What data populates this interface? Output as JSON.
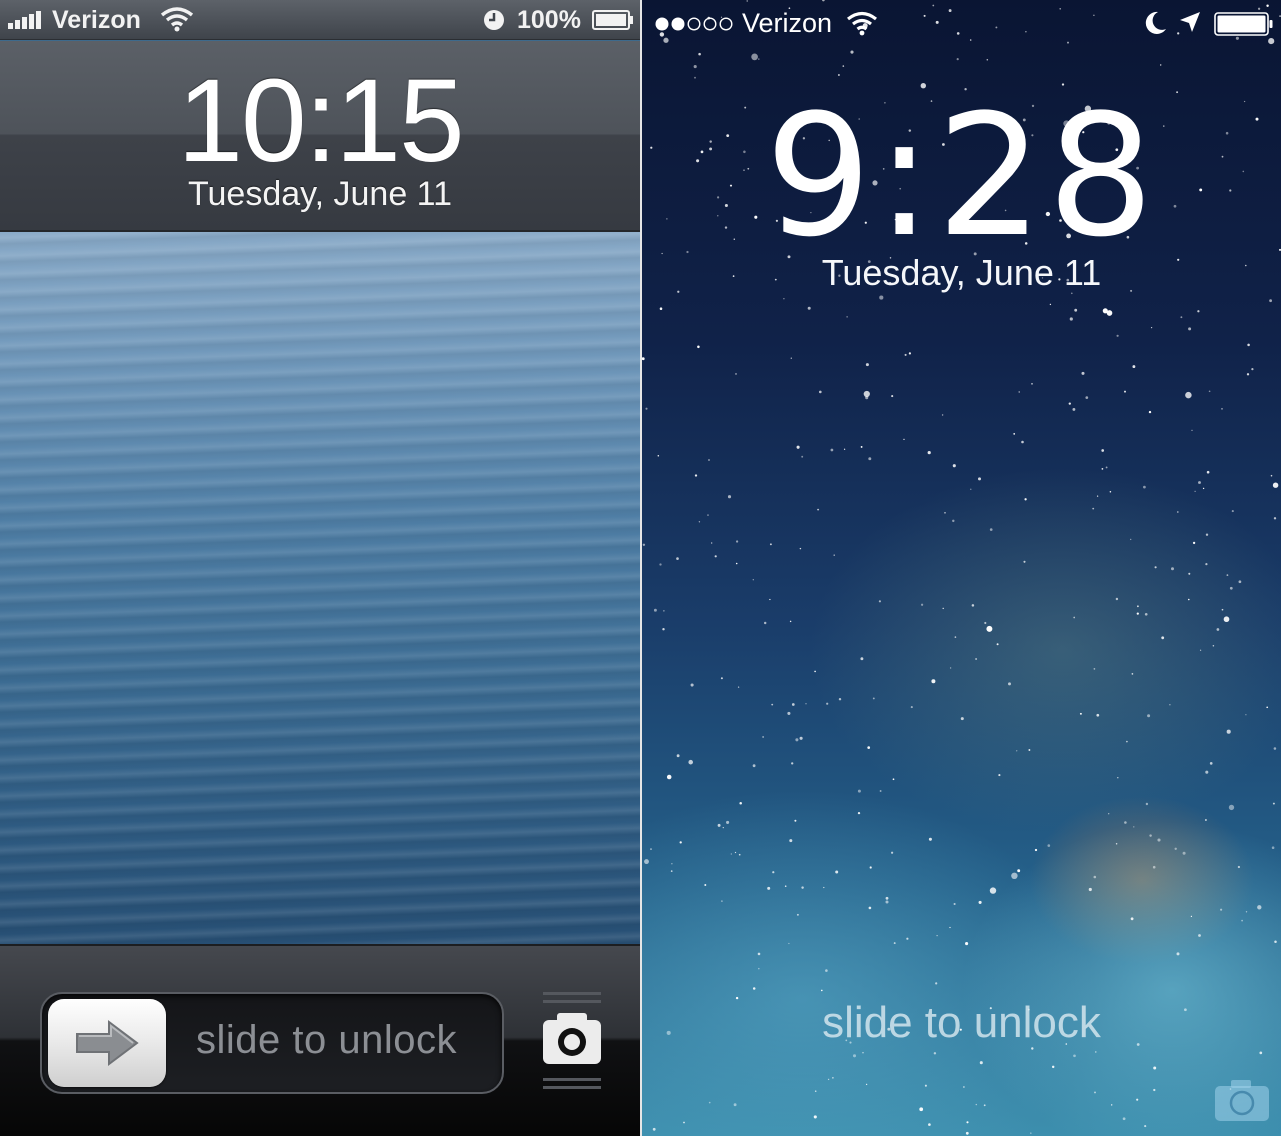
{
  "left_screen": {
    "status_bar": {
      "carrier": "Verizon",
      "battery_percent": "100%",
      "icons": [
        "signal-bars-icon",
        "wifi-icon",
        "clock-lock-icon",
        "battery-icon"
      ]
    },
    "time": "10:15",
    "date": "Tuesday, June 11",
    "slider_label": "slide to unlock",
    "icons": [
      "arrow-right-icon",
      "camera-icon"
    ]
  },
  "right_screen": {
    "status_bar": {
      "carrier": "Verizon",
      "signal_dots_filled": 2,
      "signal_dots_total": 5,
      "icons": [
        "signal-dots-icon",
        "wifi-icon",
        "moon-icon",
        "location-arrow-icon",
        "battery-icon"
      ]
    },
    "time": "9:28",
    "date": "Tuesday, June 11",
    "slider_label": "slide to unlock",
    "icons": [
      "camera-icon"
    ]
  },
  "colors": {
    "ios6_water": "#4f7ea5",
    "ios6_chrome": "#4e535a",
    "ios7_space": "#102249",
    "ios7_nebula": "#3d8fae"
  }
}
